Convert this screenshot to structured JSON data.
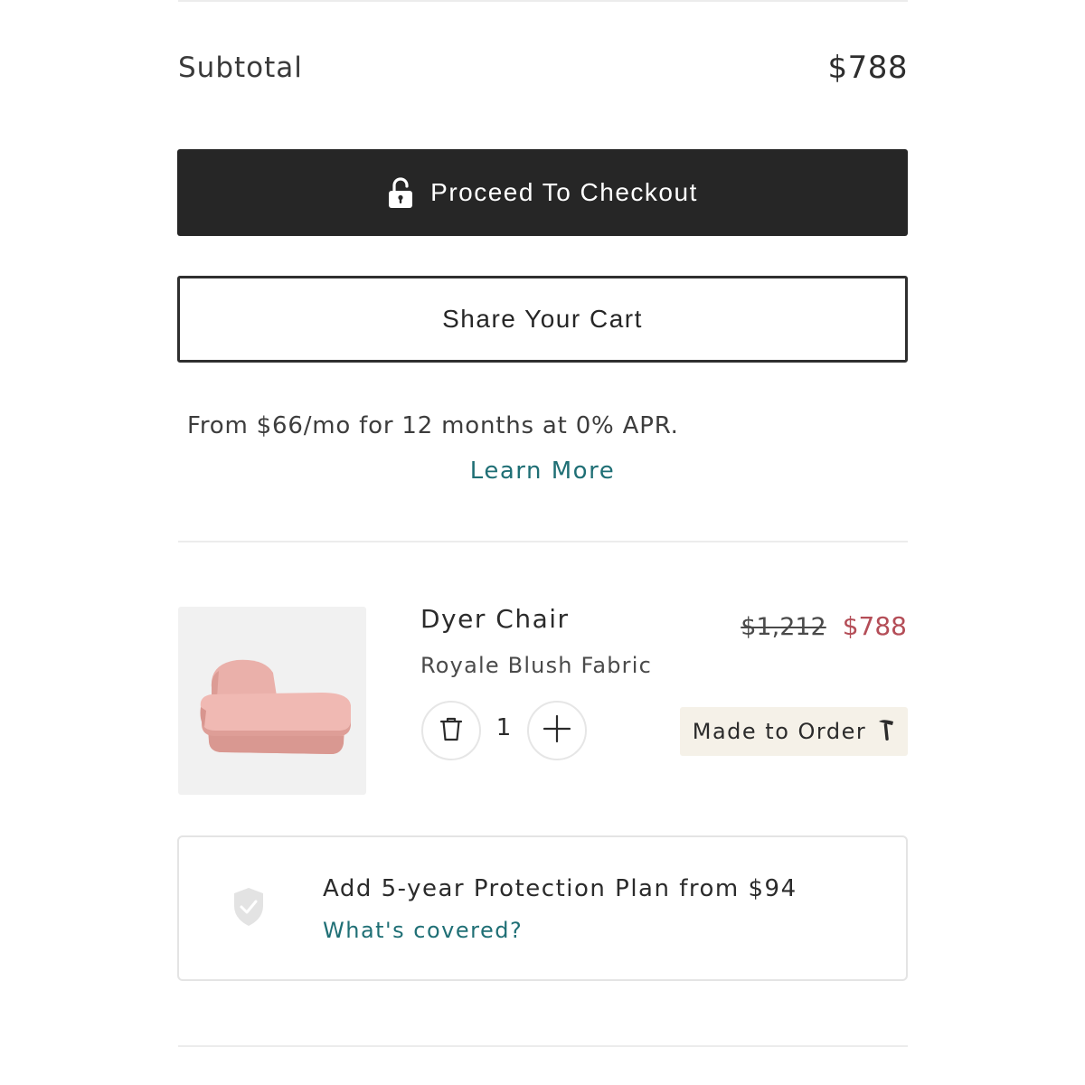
{
  "summary": {
    "subtotal_label": "Subtotal",
    "subtotal_value": "$788"
  },
  "actions": {
    "checkout_label": "Proceed To Checkout",
    "share_label": "Share Your Cart"
  },
  "financing": {
    "text": "From $66/mo for 12 months at 0% APR.",
    "link_label": "Learn More"
  },
  "cart_item": {
    "name": "Dyer Chair",
    "variant": "Royale Blush Fabric",
    "original_price": "$1,212",
    "sale_price": "$788",
    "quantity": "1",
    "badge_label": "Made to Order"
  },
  "protection": {
    "title": "Add 5-year Protection Plan from $94",
    "link_label": "What's covered?"
  },
  "icons": {
    "lock": "lock-icon",
    "trash": "trash-icon",
    "plus": "plus-icon",
    "hammer": "hammer-icon",
    "shield": "shield-check-icon"
  },
  "colors": {
    "primary_button": "#262626",
    "link": "#1f6f75",
    "sale_price": "#b44d57",
    "badge_bg": "#f5f1e8",
    "product_fabric": "#eab0aa"
  }
}
